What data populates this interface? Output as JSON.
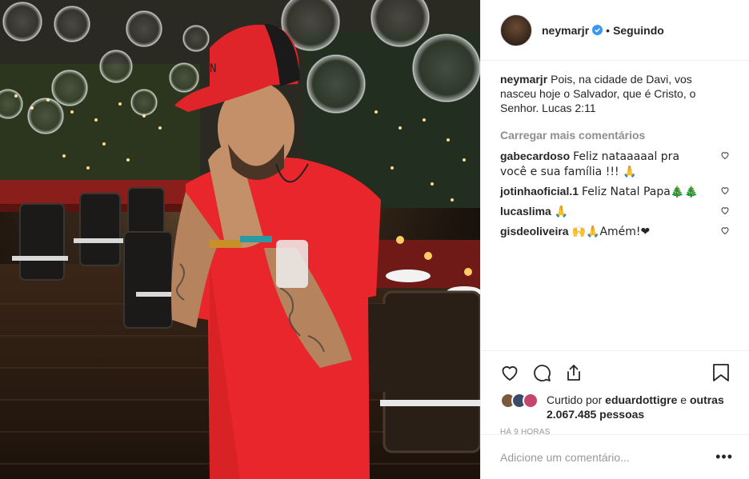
{
  "post": {
    "photo_alt": "Neymar rezando em festa de Natal",
    "author": {
      "username": "neymarjr",
      "verified": true,
      "follow_state": "Seguindo",
      "separator": "•"
    },
    "caption": {
      "username": "neymarjr",
      "text": "Pois, na cidade de Davi, vos nasceu hoje o Salvador, que é Cristo, o Senhor. Lucas 2:11"
    },
    "load_more": "Carregar mais comentários",
    "comments": [
      {
        "username": "gabecardoso",
        "text": "Feliz nataaaaal pra você e sua família !!! 🙏"
      },
      {
        "username": "jotinhaoficial.1",
        "text": "Feliz Natal Papa🎄🎄"
      },
      {
        "username": "lucaslima",
        "text": "🙏"
      },
      {
        "username": "gisdeoliveira",
        "text": "🙌🙏Amém!❤"
      }
    ],
    "likes": {
      "prefix": "Curtido por",
      "first_liker": "eduardottigre",
      "connector": "e",
      "others": "outras 2.067.485 pessoas"
    },
    "timestamp": "Há 9 horas",
    "add_comment_placeholder": "Adicione um comentário...",
    "more_options": "•••"
  },
  "colors": {
    "verified_blue": "#3897f0",
    "divider": "#efefef",
    "muted_text": "#8e8e8e",
    "heart_red": "#ed4956"
  },
  "icons": {
    "like": "heart-outline-icon",
    "comment": "speech-bubble-icon",
    "share": "share-arrow-icon",
    "save": "bookmark-icon"
  }
}
